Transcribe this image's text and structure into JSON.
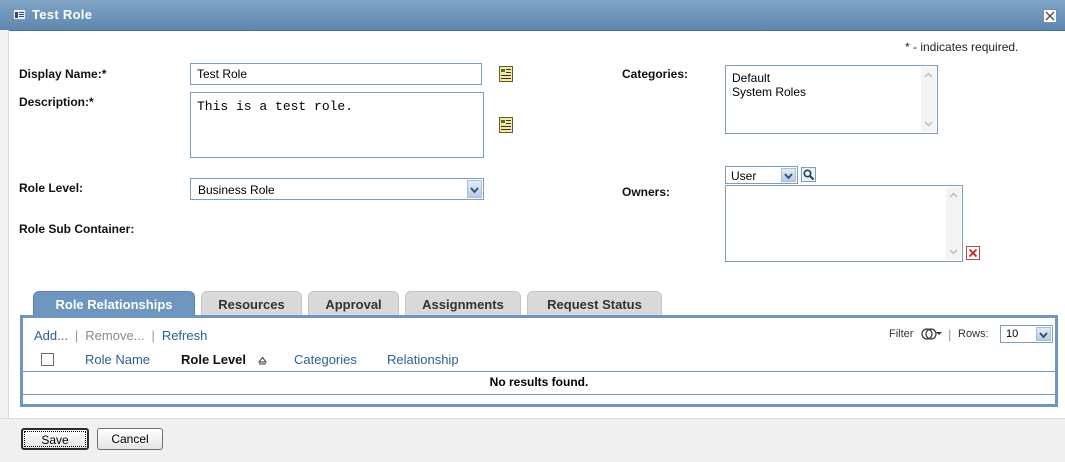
{
  "window": {
    "title": "Test Role",
    "icon": "role-icon",
    "close_icon": "close-icon"
  },
  "form": {
    "required_note": "* - indicates required.",
    "display_name_label": "Display Name:*",
    "display_name_value": "Test Role",
    "description_label": "Description:*",
    "description_value": "This is a test role.",
    "categories_label": "Categories:",
    "categories_options": [
      "Default",
      "System Roles"
    ],
    "role_level_label": "Role Level:",
    "role_level_value": "Business Role",
    "owners_label": "Owners:",
    "owners_type_value": "User",
    "sub_container_label": "Role Sub Container:",
    "localize_icon": "localize-icon",
    "search_icon": "search-icon",
    "delete_icon": "delete-icon"
  },
  "tabs": [
    {
      "label": "Role Relationships",
      "active": true
    },
    {
      "label": "Resources",
      "active": false
    },
    {
      "label": "Approval",
      "active": false
    },
    {
      "label": "Assignments",
      "active": false
    },
    {
      "label": "Request Status",
      "active": false
    }
  ],
  "toolbar": {
    "add": "Add...",
    "remove": "Remove...",
    "refresh": "Refresh",
    "filter": "Filter",
    "rows_label": "Rows:",
    "rows_value": "10"
  },
  "table": {
    "columns": [
      "Role Name",
      "Role Level",
      "Categories",
      "Relationship"
    ],
    "sorted_column": "Role Level",
    "sort_icon": "sort-ascending-icon",
    "empty_message": "No results found."
  },
  "footer": {
    "save_label": "Save",
    "cancel_label": "Cancel"
  },
  "colors": {
    "accent": "#6e96bf",
    "titlebar": "#6d93b9",
    "link": "#2b5f93"
  }
}
